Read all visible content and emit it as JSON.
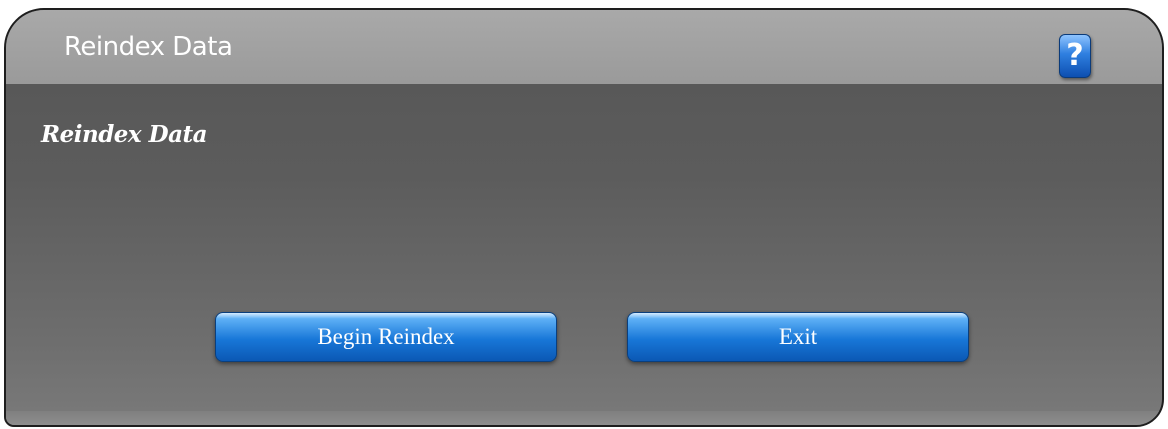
{
  "window": {
    "title": "Reindex Data",
    "help_icon": "question-mark-icon",
    "help_glyph": "?"
  },
  "main": {
    "heading": "Reindex Data"
  },
  "buttons": {
    "begin_label": "Begin Reindex",
    "exit_label": "Exit"
  },
  "colors": {
    "button_blue": "#1877d8",
    "panel_gray": "#5c5c5c",
    "titlebar_gray": "#a0a0a0"
  }
}
